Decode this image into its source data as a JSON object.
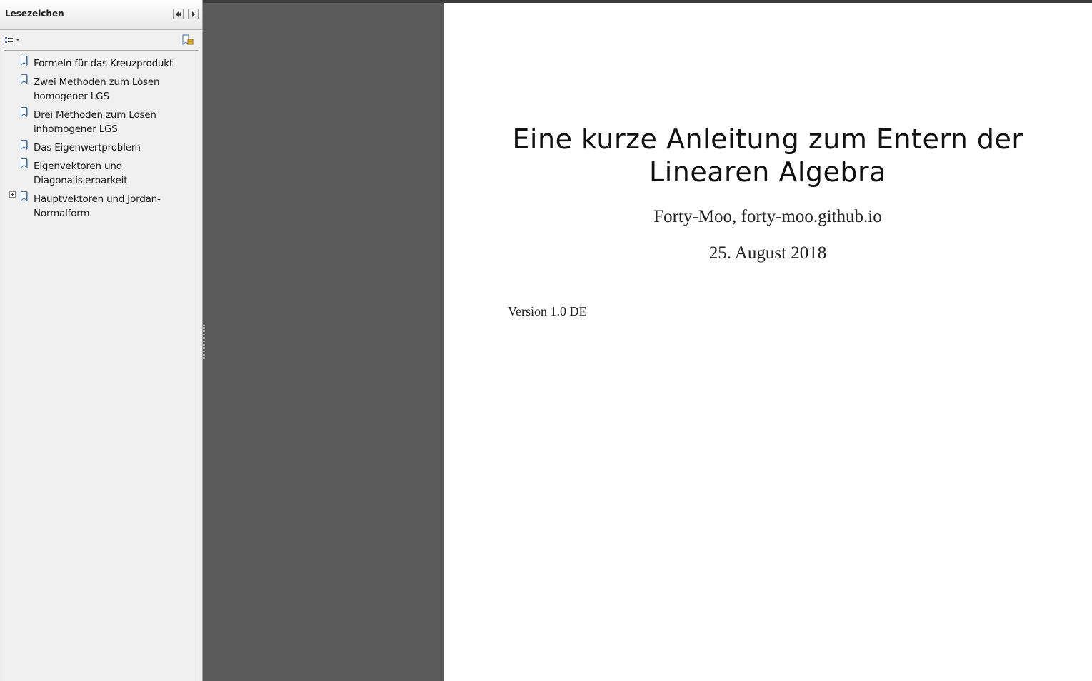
{
  "bookmarks_panel": {
    "title": "Lesezeichen",
    "items": [
      {
        "label": "Formeln für das Kreuzprodukt",
        "expandable": false
      },
      {
        "label": "Zwei Methoden zum Lösen homogener LGS",
        "expandable": false
      },
      {
        "label": "Drei Methoden zum Lösen inhomogener LGS",
        "expandable": false
      },
      {
        "label": "Das Eigenwertproblem",
        "expandable": false
      },
      {
        "label": "Eigenvektoren und Diagonalisierbarkeit",
        "expandable": false
      },
      {
        "label": "Hauptvektoren und Jordan-Normalform",
        "expandable": true
      }
    ]
  },
  "document": {
    "title_line1": "Eine kurze Anleitung zum Entern der",
    "title_line2": "Linearen Algebra",
    "author": "Forty-Moo, forty-moo.github.io",
    "date": "25. August 2018",
    "version": "Version 1.0 DE"
  },
  "colors": {
    "viewer_background": "#5a5a5a",
    "page_background": "#ffffff",
    "panel_background": "#f0f0f0",
    "bookmark_icon": "#4a6fa5"
  }
}
